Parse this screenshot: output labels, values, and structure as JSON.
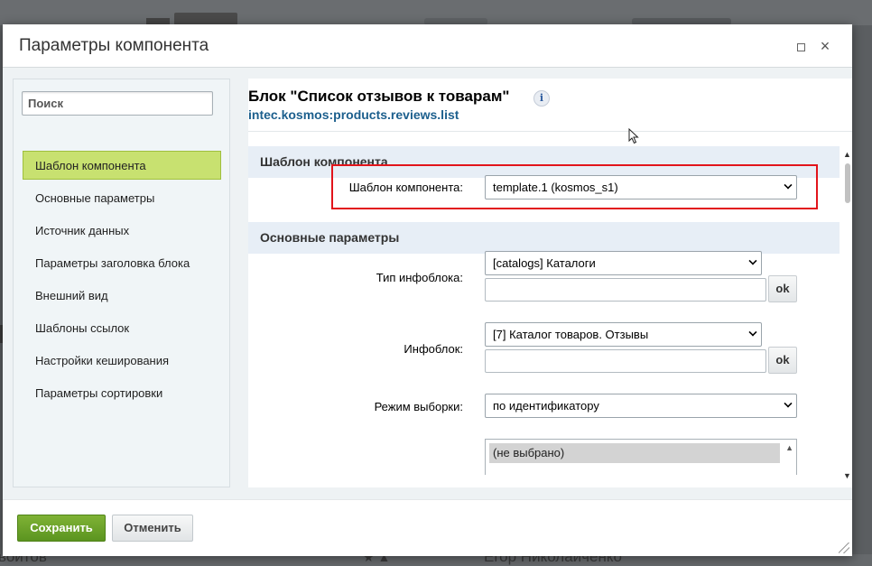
{
  "dialog": {
    "title": "Параметры компонента"
  },
  "sidebar": {
    "search_placeholder": "Поиск",
    "items": [
      {
        "label": "Шаблон компонента",
        "active": true
      },
      {
        "label": "Основные параметры"
      },
      {
        "label": "Источник данных"
      },
      {
        "label": "Параметры заголовка блока"
      },
      {
        "label": "Внешний вид"
      },
      {
        "label": "Шаблоны ссылок"
      },
      {
        "label": "Настройки кеширования"
      },
      {
        "label": "Параметры сортировки"
      }
    ]
  },
  "main": {
    "block_title": "Блок \"Список отзывов к товарам\"",
    "info_icon_glyph": "i",
    "block_code": "intec.kosmos:products.reviews.list",
    "sections": [
      {
        "title": "Шаблон компонента"
      },
      {
        "title": "Основные параметры"
      }
    ],
    "fields": {
      "template": {
        "label": "Шаблон компонента:",
        "value": "template.1 (kosmos_s1)"
      },
      "iblock_type": {
        "label": "Тип инфоблока:",
        "value": "[catalogs] Каталоги",
        "ok": "ok"
      },
      "iblock": {
        "label": "Инфоблок:",
        "value": "[7] Каталог товаров. Отзывы",
        "ok": "ok"
      },
      "mode": {
        "label": "Режим выборки:",
        "value": "по идентификатору"
      },
      "elements": {
        "option": "(не выбрано)"
      }
    }
  },
  "footer": {
    "save_label": "Сохранить",
    "cancel_label": "Отменить"
  },
  "background": {
    "bottom_left_text": "воитов",
    "bottom_right_text": "Егор Николаиченко",
    "star": "★ ▲"
  },
  "colors": {
    "active_tab": "#c8e170",
    "save_button": "#6aa22a",
    "link": "#1c5f8d",
    "highlight": "#e2141b",
    "section_bg": "#e7eef6"
  }
}
